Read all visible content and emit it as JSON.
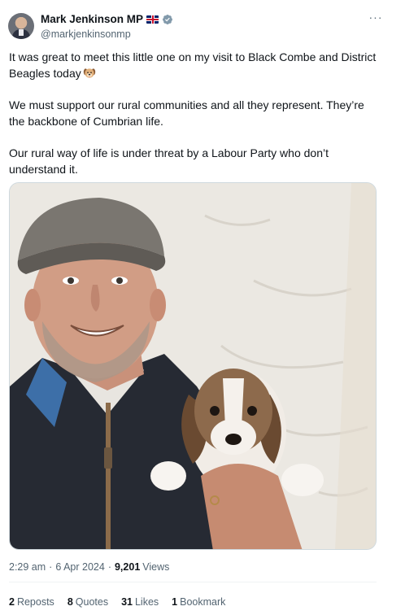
{
  "author": {
    "name": "Mark Jenkinson MP",
    "handle": "@markjenkinsonmp"
  },
  "tweet": {
    "paragraphs": [
      "It was great to meet this little one on my visit to Black Combe and District Beagles today",
      "We must support our rural communities and all they represent. They’re the backbone of Cumbrian life.",
      "Our rural way of life is under threat by a Labour Party who don’t understand it."
    ]
  },
  "meta": {
    "time": "2:29 am",
    "separator": "·",
    "date": "6 Apr 2024",
    "views_count": "9,201",
    "views_label": "Views"
  },
  "stats": {
    "reposts_count": "2",
    "reposts_label": "Reposts",
    "quotes_count": "8",
    "quotes_label": "Quotes",
    "likes_count": "31",
    "likes_label": "Likes",
    "bookmarks_count": "1",
    "bookmarks_label": "Bookmark"
  },
  "icons": {
    "more": "more-icon",
    "verified": "verified-badge-icon",
    "flag": "union-flag-icon",
    "emoji": "dog-face-emoji"
  },
  "colors": {
    "text": "#0f1419",
    "secondary": "#536471",
    "verified": "#829aab",
    "border": "#cfd9de"
  }
}
